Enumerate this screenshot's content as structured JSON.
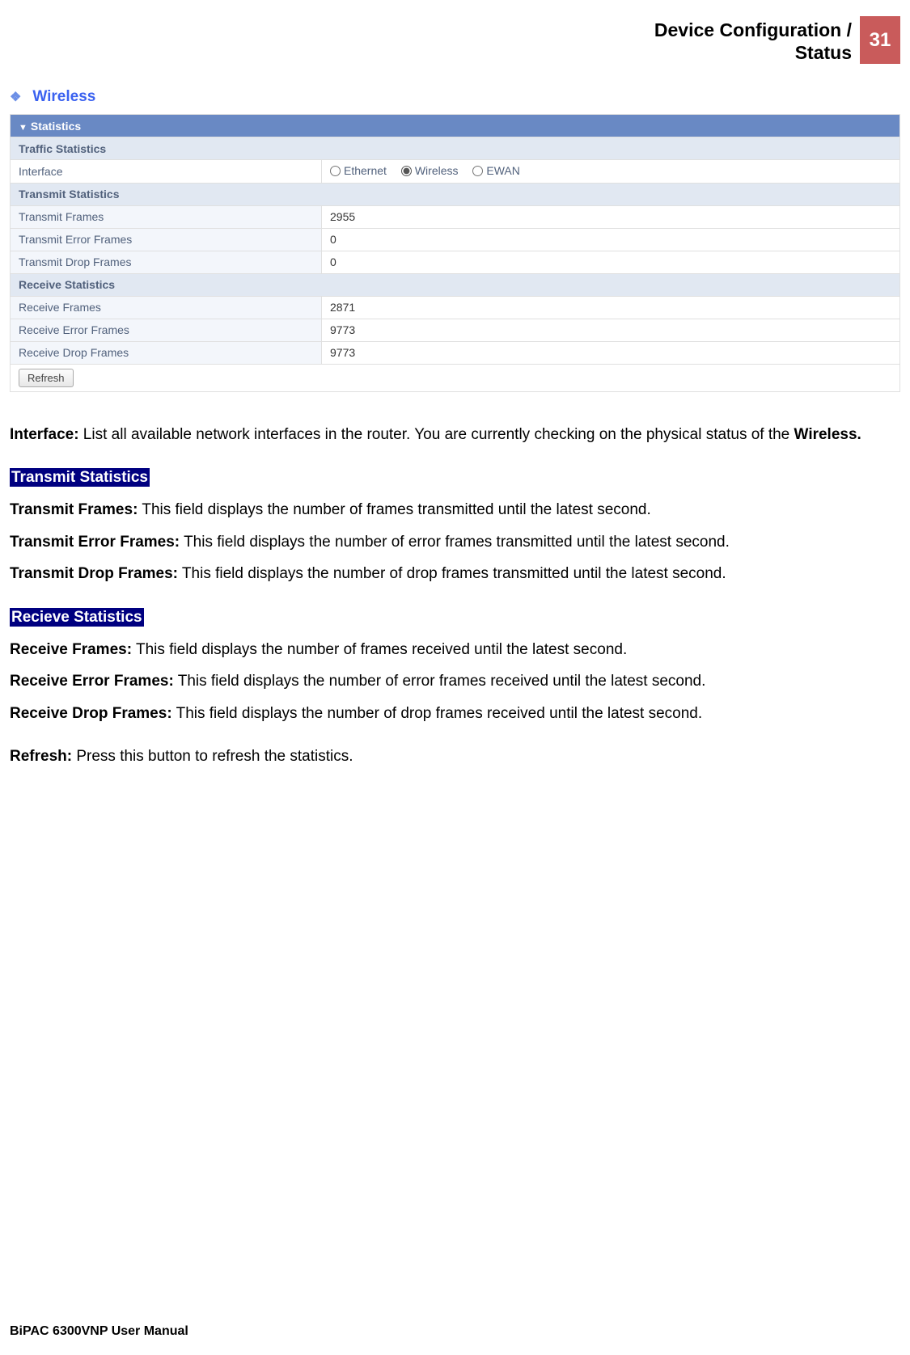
{
  "header": {
    "title_line1": "Device Configuration /",
    "title_line2": "Status",
    "page_number": "31"
  },
  "section_title": "Wireless",
  "stats_panel": {
    "main_header": "Statistics",
    "traffic_header": "Traffic Statistics",
    "interface_label": "Interface",
    "interface_options": [
      "Ethernet",
      "Wireless",
      "EWAN"
    ],
    "interface_selected": "Wireless",
    "tx_header": "Transmit Statistics",
    "tx_rows": [
      {
        "label": "Transmit Frames",
        "value": "2955"
      },
      {
        "label": "Transmit Error Frames",
        "value": "0"
      },
      {
        "label": "Transmit Drop Frames",
        "value": "0"
      }
    ],
    "rx_header": "Receive Statistics",
    "rx_rows": [
      {
        "label": "Receive Frames",
        "value": "2871"
      },
      {
        "label": "Receive Error Frames",
        "value": "9773"
      },
      {
        "label": "Receive Drop Frames",
        "value": "9773"
      }
    ],
    "refresh_button": "Refresh"
  },
  "desc": {
    "interface_bold": "Interface:",
    "interface_text": " List all available network interfaces in the router.  You are currently checking on the physical status of the ",
    "interface_bold2": "Wireless.",
    "tx_heading": "Transmit Statistics",
    "tx_frames_bold": "Transmit Frames:",
    "tx_frames_text": " This field displays the number of frames transmitted until the latest second.",
    "tx_err_bold": "Transmit Error Frames:",
    "tx_err_text": " This field displays the number of error frames transmitted until the latest second.",
    "tx_drop_bold": "Transmit Drop Frames:",
    "tx_drop_text": " This field displays the number of drop frames transmitted until the latest second.",
    "rx_heading": "Recieve Statistics",
    "rx_frames_bold": "Receive Frames:",
    "rx_frames_text": " This field displays the number of frames received until the latest second.",
    "rx_err_bold": "Receive Error Frames:",
    "rx_err_text": " This field displays the number of error frames received until the latest second.",
    "rx_drop_bold": "Receive Drop Frames:",
    "rx_drop_text": " This field displays the number of drop frames received until the latest second.",
    "refresh_bold": "Refresh:",
    "refresh_text": " Press this button to refresh the statistics."
  },
  "footer": "BiPAC 6300VNP User Manual"
}
